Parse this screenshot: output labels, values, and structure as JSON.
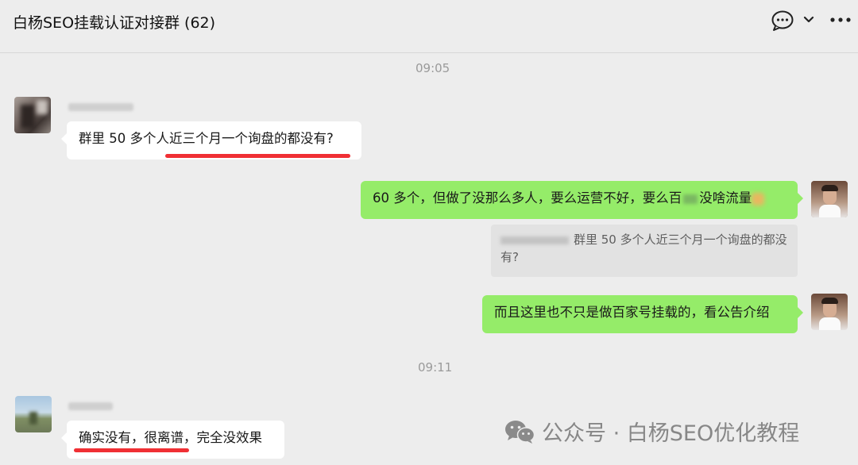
{
  "header": {
    "title": "白杨SEO挂载认证对接群 (62)",
    "icons": [
      "chat-bubble-icon",
      "chevron-down-icon",
      "more-icon"
    ]
  },
  "messages": {
    "time1": "09:05",
    "m1_text": "群里 50 多个人近三个月一个询盘的都没有?",
    "m2_text": "60 多个，但做了没那么多人，要么运营不好，要么百",
    "m2_tail": "没啥流量",
    "m2_quote_line1": "群里 50 多个人近三个月一个询盘的都没",
    "m2_quote_line2": "有?",
    "m3_text": "而且这里也不只是做百家号挂载的，看公告介绍",
    "time2": "09:11",
    "m4_text": "确实没有，很离谱，完全没效果"
  },
  "watermark": {
    "text": "公众号 · 白杨SEO优化教程",
    "icon": "wechat-icon"
  },
  "colors": {
    "background": "#ededed",
    "bubble_green": "#95ec69",
    "bubble_white": "#ffffff",
    "underline_red": "#f02f34"
  }
}
